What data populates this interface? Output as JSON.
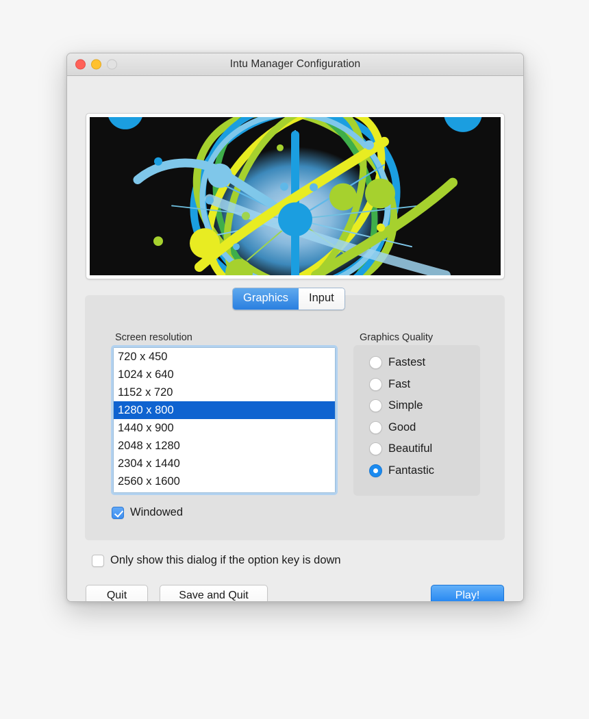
{
  "window": {
    "title": "Intu Manager Configuration",
    "traffic_lights": [
      {
        "name": "close",
        "color": "#ff6259"
      },
      {
        "name": "minimize",
        "color": "#ffc12f"
      },
      {
        "name": "zoom",
        "color": "#e2e2e2"
      }
    ]
  },
  "banner": {
    "alt": "abstract network globe graphic",
    "background": "#0d0d0d",
    "colors": {
      "blue": "#1b9ee0",
      "light_blue": "#7fc7ea",
      "green": "#3fae4a",
      "lime": "#a6d12e",
      "yellow": "#e8ec22"
    }
  },
  "tabs": [
    {
      "label": "Graphics",
      "selected": true
    },
    {
      "label": "Input",
      "selected": false
    }
  ],
  "screen_resolution": {
    "label": "Screen resolution",
    "options": [
      "720 x 450",
      "1024 x 640",
      "1152 x 720",
      "1280 x 800",
      "1440 x 900",
      "2048 x 1280",
      "2304 x 1440",
      "2560 x 1600"
    ],
    "selected_index": 3,
    "selected_value": "1280 x 800",
    "selection_color": "#0f63d0"
  },
  "graphics_quality": {
    "label": "Graphics Quality",
    "options": [
      {
        "label": "Fastest",
        "selected": false
      },
      {
        "label": "Fast",
        "selected": false
      },
      {
        "label": "Simple",
        "selected": false
      },
      {
        "label": "Good",
        "selected": false
      },
      {
        "label": "Beautiful",
        "selected": false
      },
      {
        "label": "Fantastic",
        "selected": true
      }
    ],
    "selected_value": "Fantastic",
    "accent_color": "#1b8bf0"
  },
  "checkboxes": {
    "windowed": {
      "label": "Windowed",
      "checked": true
    },
    "option_key": {
      "label": "Only show this dialog if the option key is down",
      "checked": false
    }
  },
  "buttons": {
    "quit": "Quit",
    "save_and_quit": "Save and Quit",
    "play": "Play!",
    "play_color": "#1a7ff0"
  }
}
